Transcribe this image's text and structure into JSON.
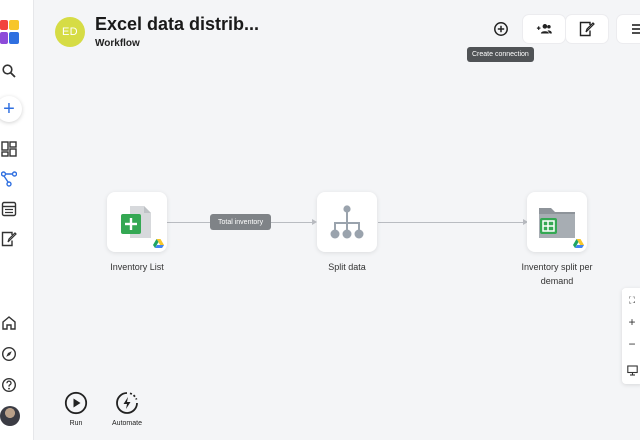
{
  "workspace": {
    "initials": "ED",
    "title": "Excel data distrib...",
    "subtitle": "Workflow"
  },
  "toolbar": {
    "tooltip": "Create connection"
  },
  "nodes": [
    {
      "label": "Inventory List"
    },
    {
      "label": "Split data"
    },
    {
      "label_line1": "Inventory split per",
      "label_line2": "demand"
    }
  ],
  "edges": [
    {
      "label": "Total inventory"
    }
  ],
  "zoom": {
    "fit": "⛶",
    "in": "+",
    "out": "−"
  },
  "actions": {
    "run": "Run",
    "automate": "Automate"
  },
  "colors": {
    "accent": "#2f6fe0",
    "avatar": "#d6dc45",
    "sheets_green": "#34a853"
  }
}
